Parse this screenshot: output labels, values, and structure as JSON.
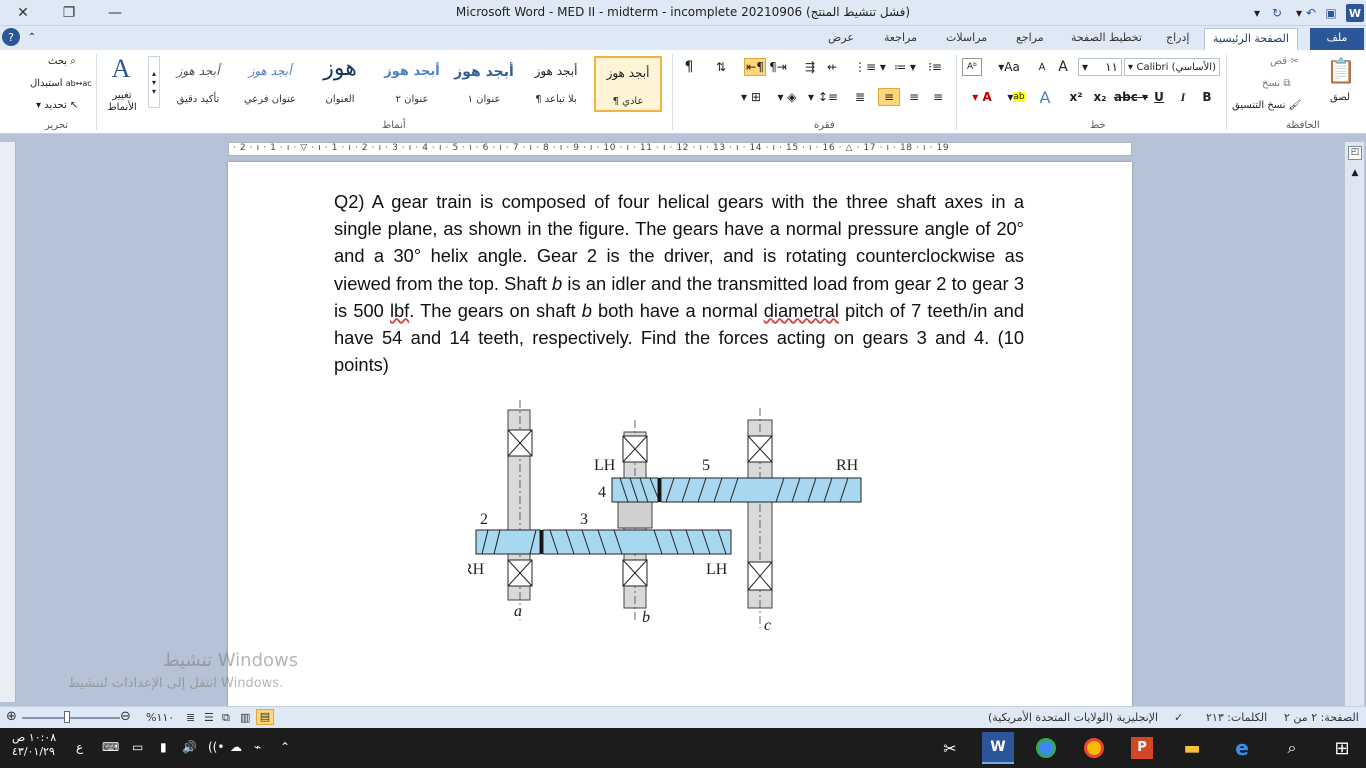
{
  "window": {
    "title": "Microsoft Word  -  MED II - midterm - incomplete 20210906 (فشل تنشيط المنتج)",
    "close_glyph": "✕",
    "restore_glyph": "❐",
    "minimize_glyph": "—"
  },
  "tabs": {
    "file": "ملف",
    "home": "الصفحة الرئيسية",
    "insert": "إدراج",
    "page_layout": "تخطيط الصفحة",
    "references": "مراجع",
    "mailings": "مراسلات",
    "review": "مراجعة",
    "view": "عرض"
  },
  "ribbon": {
    "clipboard": {
      "group": "الحافظة",
      "paste": "لصق",
      "cut": "قص",
      "copy": "نسخ",
      "format_painter": "نسخ التنسيق"
    },
    "font": {
      "group": "خط",
      "font_name": "Calibri (الأساسي)",
      "font_size": "١١",
      "bold": "B",
      "italic": "I",
      "underline": "U",
      "strike": "abc",
      "subscript": "x₂",
      "superscript": "x²",
      "grow": "A",
      "shrink": "A",
      "case": "Aa"
    },
    "paragraph": {
      "group": "فقرة",
      "pilcrow": "¶"
    },
    "styles": {
      "group": "أنماط",
      "items": [
        {
          "preview": "أبجد هوز",
          "name": "¶ عادي"
        },
        {
          "preview": "أبجد هوز",
          "name": "¶ بلا تباعد"
        },
        {
          "preview": "أبجد هوز",
          "name": "عنوان ١"
        },
        {
          "preview": "أبجد هوز",
          "name": "عنوان ٢"
        },
        {
          "preview": "هوز",
          "name": "العنوان"
        },
        {
          "preview": "أبجد هوز",
          "name": "عنوان فرعي"
        },
        {
          "preview": "أبجد هوز",
          "name": "تأكيد دقيق"
        }
      ],
      "change_styles": "تغيير الأنماط"
    },
    "editing": {
      "group": "تحرير",
      "find": "بحث",
      "replace": "استبدال",
      "select": "تحديد"
    }
  },
  "ruler": {
    "ticks": "· 2 · ı · 1 · ı · ▽ · ı · 1 · ı · 2 · ı · 3 · ı · 4 · ı · 5 · ı · 6 · ı · 7 · ı · 8 · ı · 9 · ı · 10 · ı · 11 · ı · 12 · ı · 13 · ı · 14 · ı · 15 · ı · 16 · △ · 17 · ı · 18 · ı · 19"
  },
  "document": {
    "paragraph_parts": {
      "p1": "Q2) A gear train is composed of four helical gears with the three shaft axes in a single plane, as shown in the figure. The gears have a normal pressure angle of 20° and a 30° helix angle. Gear 2 is the driver, and is rotating counterclockwise as viewed from the top. Shaft ",
      "b1": "b",
      "p2": " is an idler and the transmitted load from gear 2 to gear 3 is 500 ",
      "unit": "lbf",
      "p3": ". The gears on shaft ",
      "b2": "b",
      "p4": " both have a normal ",
      "dp": "diametral",
      "p5": " pitch of 7 teeth/in and have 54 and 14 teeth, respectively. Find the forces acting on gears 3 and 4. (10 points)"
    },
    "figure_labels": {
      "lh_top": "LH",
      "five": "5",
      "rh_top": "RH",
      "four": "4",
      "two": "2",
      "three": "3",
      "rh_bottom": "RH",
      "lh_bottom": "LH",
      "shaft_a": "a",
      "shaft_b": "b",
      "shaft_c": "c"
    }
  },
  "watermark": {
    "line1": "تنشيط Windows",
    "line2": "انتقل إلى الإعدادات لتنشيط Windows."
  },
  "statusbar": {
    "page": "الصفحة: ٢ من ٢",
    "words": "الكلمات: ٢١٣",
    "language": "الإنجليزية (الولايات المتحدة الأمريكية)",
    "zoom": "%١١٠"
  },
  "taskbar": {
    "time": "١٠:٠٨ ص",
    "date": "٤٣/٠١/٢٩",
    "lang": "ع"
  },
  "colors": {
    "gear_fill": "#a8d8f0",
    "gear_stroke": "#1a1a1a",
    "shaft_fill": "#d9d9d9",
    "accent": "#2b579a"
  }
}
